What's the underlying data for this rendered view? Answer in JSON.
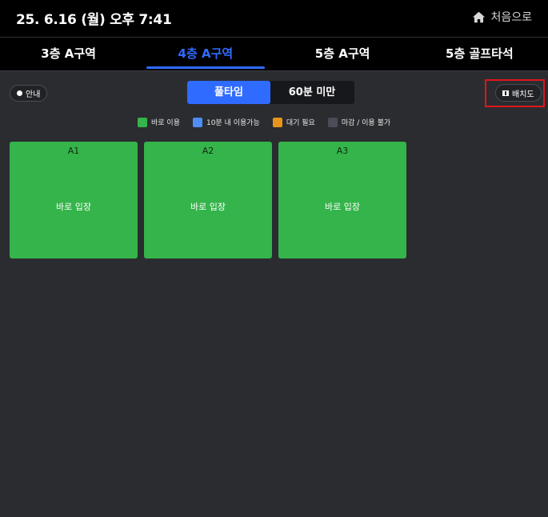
{
  "header": {
    "datetime": "25. 6.16 (월) 오후 7:41",
    "home_label": "처음으로",
    "home_icon": "home-icon"
  },
  "tabs": [
    {
      "label": "3층 A구역",
      "active": false
    },
    {
      "label": "4층 A구역",
      "active": true
    },
    {
      "label": "5층 A구역",
      "active": false
    },
    {
      "label": "5층 골프타석",
      "active": false
    }
  ],
  "toolbar": {
    "info_label": "안내",
    "info_icon": "info-icon",
    "segments": [
      {
        "label": "풀타임",
        "active": true
      },
      {
        "label": "60분 미만",
        "active": false
      }
    ],
    "layout_label": "배치도",
    "layout_icon": "map-icon"
  },
  "legend": [
    {
      "label": "바로 이용",
      "color": "#34b44a"
    },
    {
      "label": "10분 내 이용가능",
      "color": "#4f8ef7"
    },
    {
      "label": "대기 필요",
      "color": "#e8941a"
    },
    {
      "label": "마감 / 이용 불가",
      "color": "#4a4d58"
    }
  ],
  "seats": [
    {
      "id": "A1",
      "status": "바로 입장",
      "color": "#34b44a"
    },
    {
      "id": "A2",
      "status": "바로 입장",
      "color": "#34b44a"
    },
    {
      "id": "A3",
      "status": "바로 입장",
      "color": "#34b44a"
    }
  ],
  "colors": {
    "accent": "#2f6bff",
    "highlight": "#e0161b",
    "background": "#2a2c30",
    "header_bg": "#000000"
  }
}
